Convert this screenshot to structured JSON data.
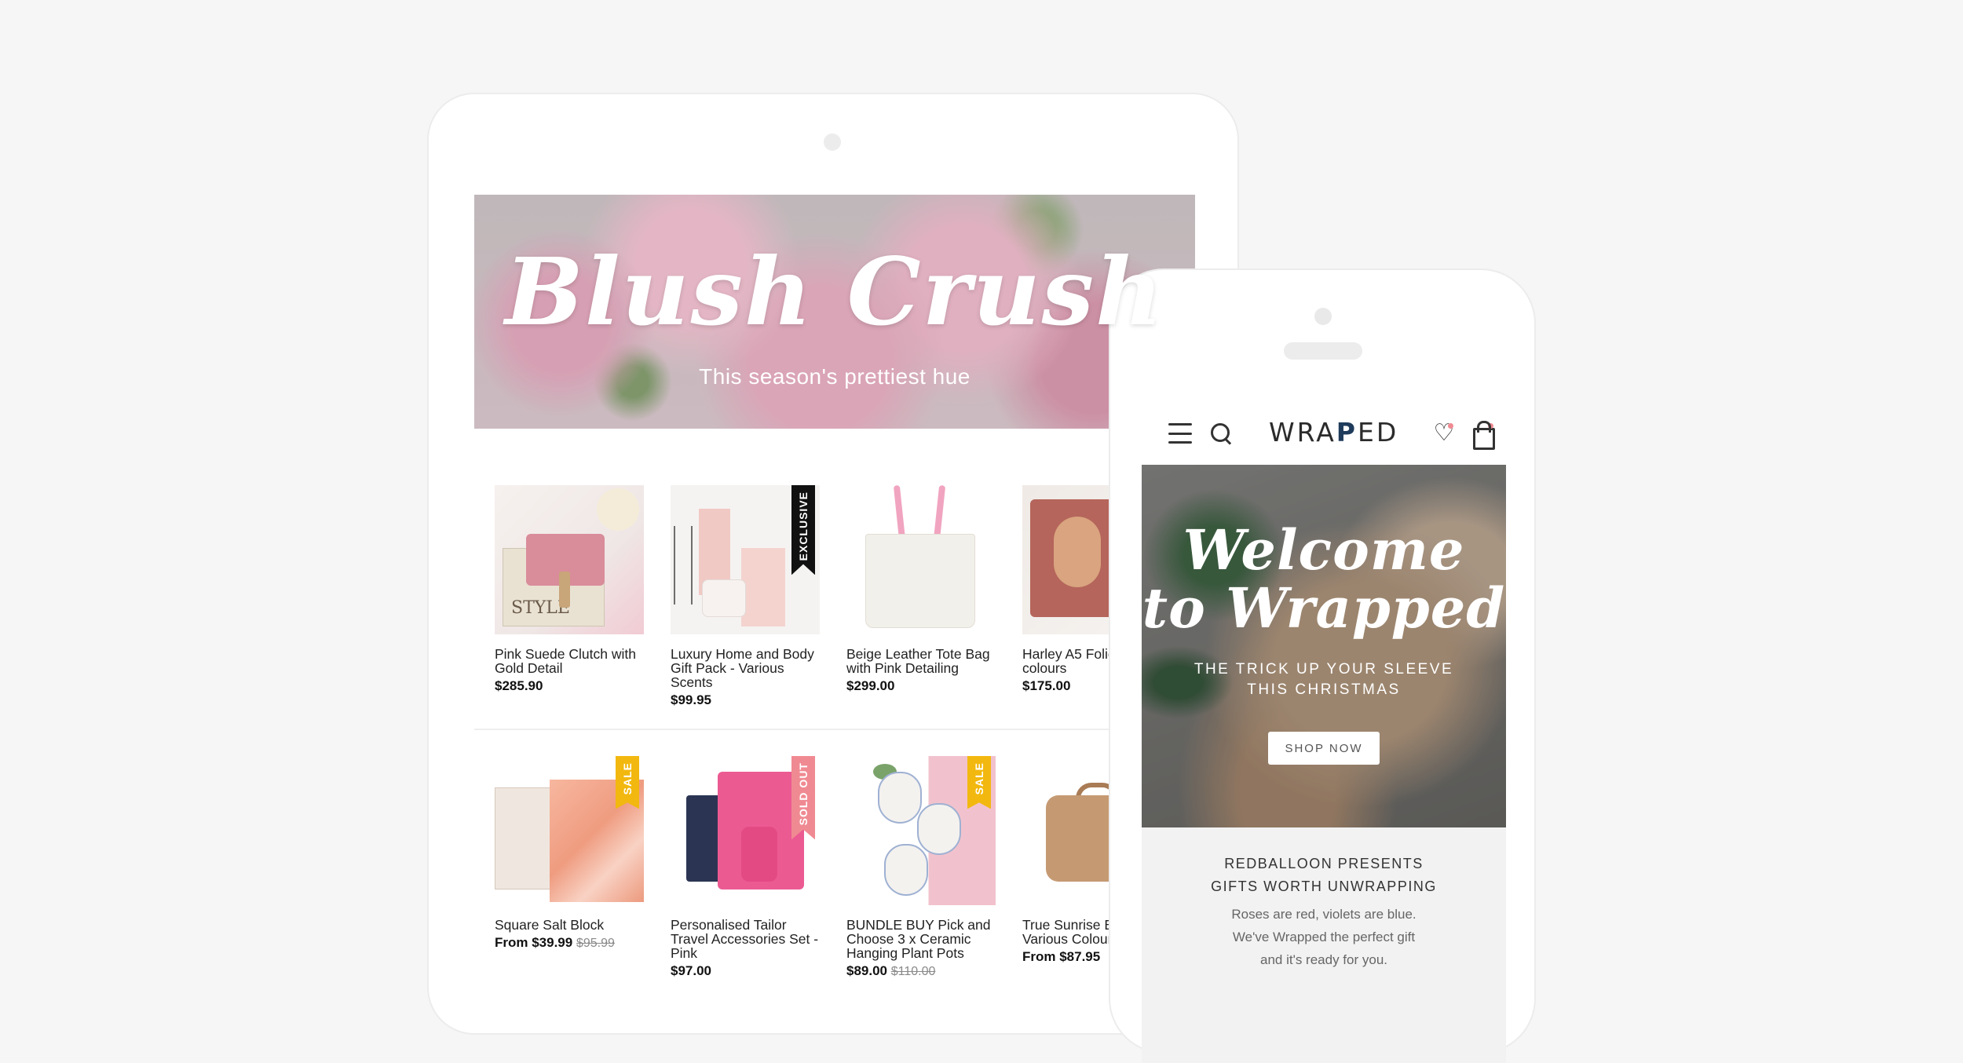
{
  "tablet": {
    "banner": {
      "title": "Blush Crush",
      "subtitle": "This season's prettiest hue"
    },
    "row1": [
      {
        "name": "Pink Suede Clutch with Gold Detail",
        "price": "$285.90",
        "was": "",
        "badge": ""
      },
      {
        "name": "Luxury Home and Body Gift Pack - Various Scents",
        "price": "$99.95",
        "was": "",
        "badge": "EXCLUSIVE"
      },
      {
        "name": "Beige Leather Tote Bag with Pink Detailing",
        "price": "$299.00",
        "was": "",
        "badge": ""
      },
      {
        "name": "Harley A5 Folio various colours",
        "price": "$175.00",
        "was": "",
        "badge": ""
      }
    ],
    "row2": [
      {
        "name": "Square Salt Block",
        "price": "From $39.99",
        "was": "$95.99",
        "badge": "SALE"
      },
      {
        "name": "Personalised Tailor Travel Accessories Set - Pink",
        "price": "$97.00",
        "was": "",
        "badge": "SOLD OUT"
      },
      {
        "name": "BUNDLE BUY Pick and Choose 3 x Ceramic Hanging Plant Pots",
        "price": "$89.00",
        "was": "$110.00",
        "badge": "SALE"
      },
      {
        "name": "True Sunrise Bag Various Colours",
        "price": "From $87.95",
        "was": "",
        "badge": ""
      }
    ]
  },
  "phone": {
    "header": {
      "logo_left": "WRA",
      "logo_bow": "P",
      "logo_right": "ED",
      "icons": [
        "menu-icon",
        "search-icon",
        "heart-icon",
        "bag-icon"
      ]
    },
    "hero": {
      "title_line1": "Welcome",
      "title_line2": "to Wrapped",
      "subtitle_line1": "THE TRICK UP YOUR SLEEVE",
      "subtitle_line2": "THIS CHRISTMAS",
      "cta": "SHOP NOW"
    },
    "promo": {
      "title_line1": "REDBALLOON PRESENTS",
      "title_line2": "GIFTS WORTH UNWRAPPING",
      "body_line1": "Roses are red, violets are blue.",
      "body_line2": "We've Wrapped the perfect gift",
      "body_line3": "and it's ready for you."
    }
  },
  "colors": {
    "badge_black": "#111111",
    "badge_sale": "#f2b80f",
    "badge_sold_out": "#f08a92",
    "logo_bow": "#1f3b5b"
  }
}
